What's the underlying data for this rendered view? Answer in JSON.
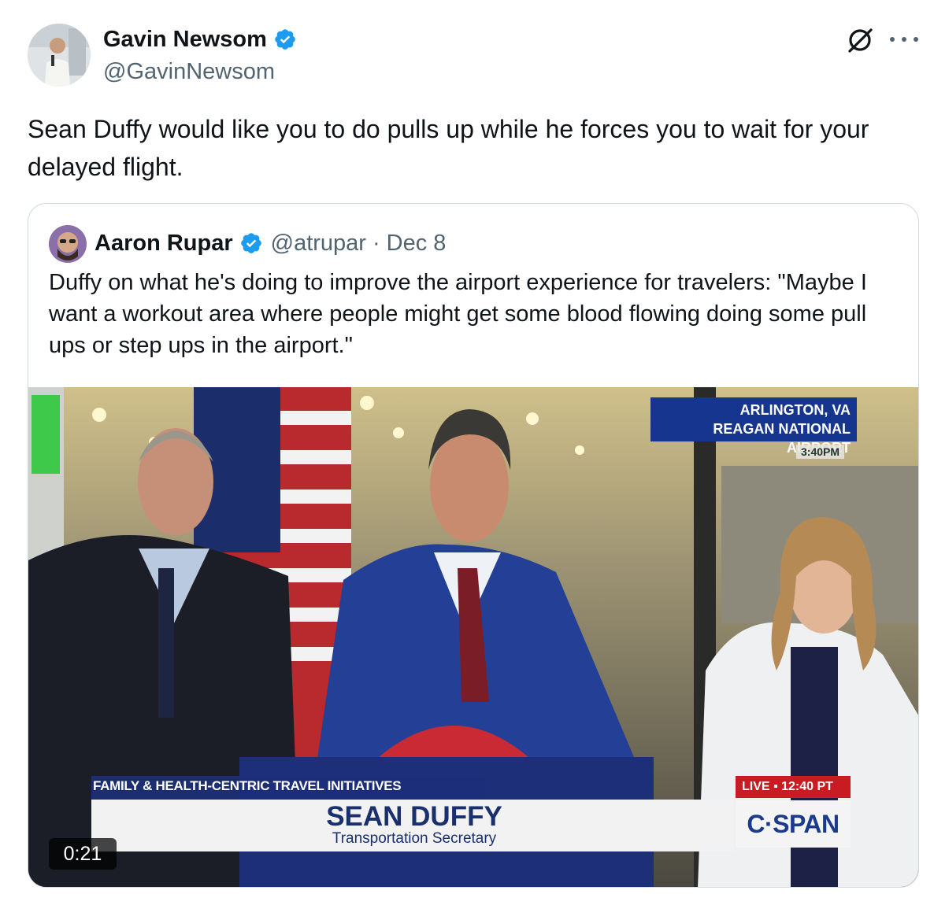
{
  "tweet": {
    "author_name": "Gavin Newsom",
    "author_handle": "@GavinNewsom",
    "text": "Sean Duffy would like you to do pulls up while he forces you to wait for your delayed flight."
  },
  "quote": {
    "author_name": "Aaron Rupar",
    "author_handle": "@atrupar",
    "separator": "·",
    "date": "Dec 8",
    "text": "Duffy on what he's doing to improve the airport experience for travelers: \"Maybe I want a workout area where people might get some blood flowing doing some pull ups or step ups in the airport.\"",
    "video": {
      "duration": "0:21",
      "location_line1": "ARLINGTON, VA",
      "location_line2": "REAGAN NATIONAL AIRPORT",
      "location_time": "3:40PM",
      "lower_third_topic": "FAMILY & HEALTH-CENTRIC TRAVEL INITIATIVES",
      "lower_third_name": "SEAN DUFFY",
      "lower_third_title": "Transportation Secretary",
      "live_badge": "LIVE ▪ 12:40 PT",
      "network": "C·SPAN"
    }
  },
  "icons": {
    "verified": "verified-badge-icon",
    "grok": "grok-icon",
    "more": "more-options-icon"
  },
  "colors": {
    "verified_blue": "#1d9bf0",
    "text_primary": "#0f1419",
    "text_secondary": "#536471",
    "border": "#cfd9de"
  }
}
